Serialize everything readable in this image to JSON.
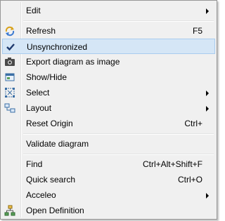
{
  "menu": {
    "items": [
      {
        "label": "Edit"
      },
      {
        "label": "Refresh",
        "shortcut": "F5"
      },
      {
        "label": "Unsynchronized",
        "checked": true
      },
      {
        "label": "Export diagram as image"
      },
      {
        "label": "Show/Hide"
      },
      {
        "label": "Select"
      },
      {
        "label": "Layout"
      },
      {
        "label": "Reset Origin",
        "shortcut": "Ctrl+"
      },
      {
        "label": "Validate diagram"
      },
      {
        "label": "Find",
        "shortcut": "Ctrl+Alt+Shift+F"
      },
      {
        "label": "Quick search",
        "shortcut": "Ctrl+O"
      },
      {
        "label": "Acceleo"
      },
      {
        "label": "Open Definition"
      }
    ],
    "colors": {
      "highlight": "#d5e6f6",
      "highlight_border": "#a9ccee",
      "checkmark": "#1f3a6e"
    }
  }
}
